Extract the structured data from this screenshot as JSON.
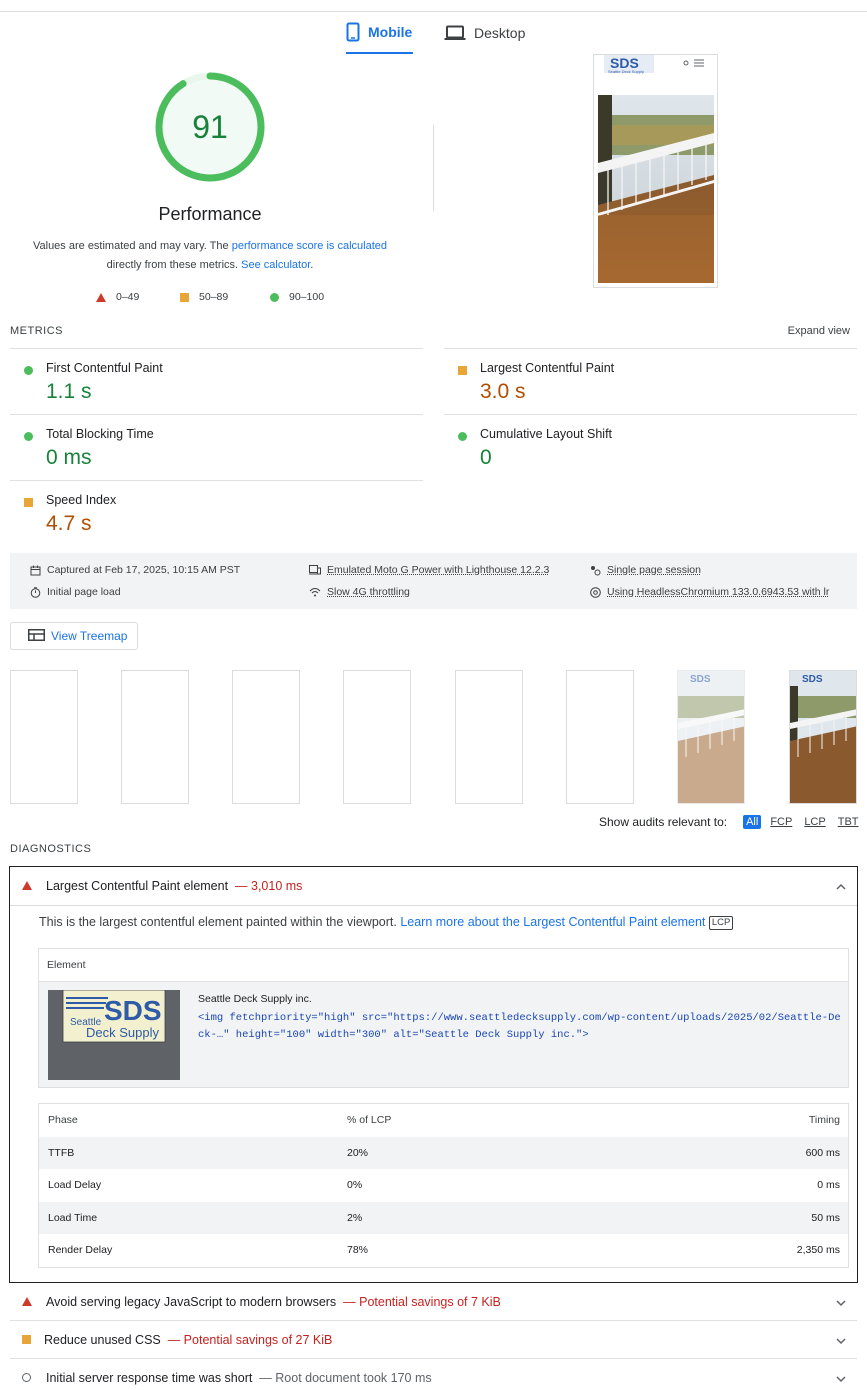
{
  "tabs": [
    {
      "label": "Mobile",
      "icon": "phone-icon",
      "active": true
    },
    {
      "label": "Desktop",
      "icon": "laptop-icon",
      "active": false
    }
  ],
  "score": {
    "value": "91",
    "title": "Performance",
    "note_pre": "Values are estimated and may vary. The ",
    "note_link1": "performance score is calculated",
    "note_mid": " directly from these metrics. ",
    "note_link2": "See calculator",
    "note_post": ".",
    "color": "#0cce6b"
  },
  "legend": [
    {
      "range": "0–49",
      "icon": "red-triangle",
      "color": "#cc3a2a"
    },
    {
      "range": "50–89",
      "icon": "orange-square",
      "color": "#e8a639"
    },
    {
      "range": "90–100",
      "icon": "green-circle",
      "color": "#4bbd5c"
    }
  ],
  "metrics": {
    "label": "METRICS",
    "expand": "Expand view",
    "items": [
      {
        "name": "First Contentful Paint",
        "value": "1.1 s",
        "rating": "good"
      },
      {
        "name": "Largest Contentful Paint",
        "value": "3.0 s",
        "rating": "average"
      },
      {
        "name": "Total Blocking Time",
        "value": "0 ms",
        "rating": "good"
      },
      {
        "name": "Cumulative Layout Shift",
        "value": "0",
        "rating": "good"
      },
      {
        "name": "Speed Index",
        "value": "4.7 s",
        "rating": "average"
      }
    ]
  },
  "runtime": {
    "captured": "Captured at Feb 17, 2025, 10:15 AM PST",
    "initial": "Initial page load",
    "device": "Emulated Moto G Power with Lighthouse 12.2.3",
    "throttle": "Slow 4G throttling",
    "session": "Single page session",
    "browser": "Using HeadlessChromium 133.0.6943.53 with lr"
  },
  "treemap_label": "View Treemap",
  "filter": {
    "label": "Show audits relevant to:",
    "options": [
      "All",
      "FCP",
      "LCP",
      "TBT"
    ]
  },
  "diagnostics": {
    "label": "DIAGNOSTICS",
    "open_audit": {
      "title": "Largest Contentful Paint element",
      "savings": "— 3,010 ms",
      "desc": "This is the largest contentful element painted within the viewport. ",
      "desc_link": "Learn more about the Largest Contentful Paint element",
      "badge": "LCP",
      "element_header": "Element",
      "element_name": "Seattle Deck Supply inc.",
      "element_code": "<img fetchpriority=\"high\" src=\"https://www.seattledecksupply.com/wp-content/uploads/2025/02/Seattle-Deck-…\" height=\"100\" width=\"300\" alt=\"Seattle Deck Supply inc.\">",
      "logo_text_big": "SDS",
      "logo_text_small1": "Seattle",
      "logo_text_small2": "Deck Supply",
      "phase_headers": [
        "Phase",
        "% of LCP",
        "Timing"
      ],
      "phases": [
        {
          "phase": "TTFB",
          "pct": "20%",
          "timing": "600 ms"
        },
        {
          "phase": "Load Delay",
          "pct": "0%",
          "timing": "0 ms"
        },
        {
          "phase": "Load Time",
          "pct": "2%",
          "timing": "50 ms"
        },
        {
          "phase": "Render Delay",
          "pct": "78%",
          "timing": "2,350 ms"
        }
      ]
    },
    "audits": [
      {
        "title": "Avoid serving legacy JavaScript to modern browsers",
        "detail": "— Potential savings of 7 KiB",
        "icon": "red-triangle"
      },
      {
        "title": "Reduce unused CSS",
        "detail": "— Potential savings of 27 KiB",
        "icon": "orange-square"
      },
      {
        "title": "Initial server response time was short",
        "detail": "— Root document took 170 ms",
        "icon": "gray-circle"
      }
    ]
  }
}
